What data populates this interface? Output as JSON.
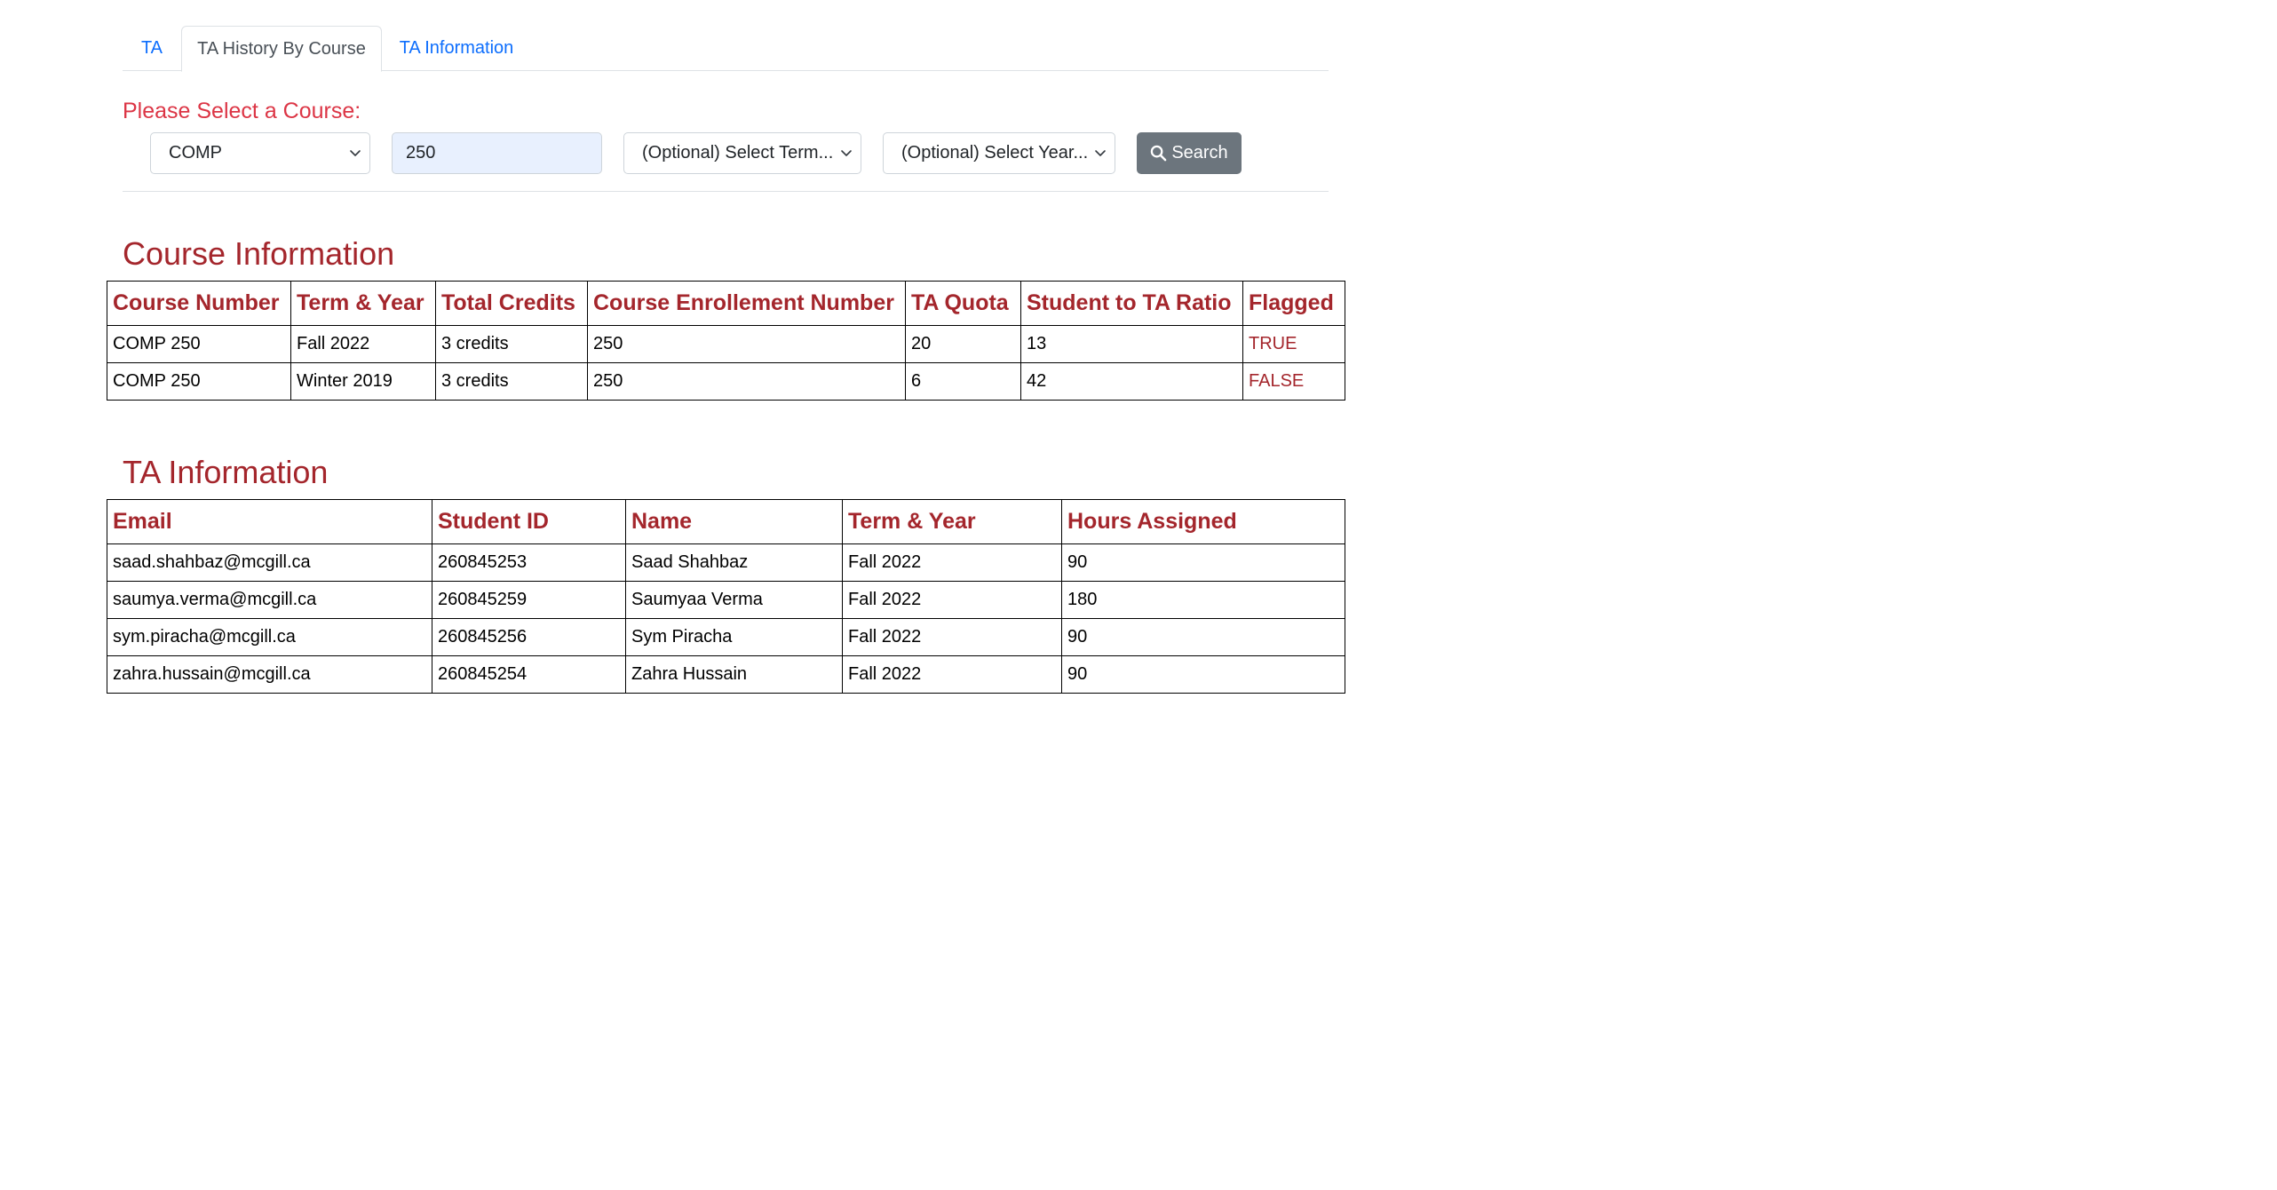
{
  "tabs": [
    {
      "label": "TA",
      "active": false
    },
    {
      "label": "TA History By Course",
      "active": true
    },
    {
      "label": "TA Information",
      "active": false
    }
  ],
  "course_select": {
    "prompt": "Please Select a Course:",
    "department": "COMP",
    "course_number": "250",
    "term_placeholder": "(Optional) Select Term...",
    "year_placeholder": "(Optional) Select Year...",
    "search_label": "Search"
  },
  "course_info": {
    "title": "Course Information",
    "headers": [
      "Course Number",
      "Term & Year",
      "Total Credits",
      "Course Enrollement Number",
      "TA Quota",
      "Student to TA Ratio",
      "Flagged"
    ],
    "rows": [
      [
        "COMP 250",
        "Fall 2022",
        "3 credits",
        "250",
        "20",
        "13",
        "TRUE"
      ],
      [
        "COMP 250",
        "Winter 2019",
        "3 credits",
        "250",
        "6",
        "42",
        "FALSE"
      ]
    ]
  },
  "ta_info": {
    "title": "TA Information",
    "headers": [
      "Email",
      "Student ID",
      "Name",
      "Term & Year",
      "Hours Assigned"
    ],
    "rows": [
      [
        "saad.shahbaz@mcgill.ca",
        "260845253",
        "Saad Shahbaz",
        "Fall 2022",
        "90"
      ],
      [
        "saumya.verma@mcgill.ca",
        "260845259",
        "Saumyaa Verma",
        "Fall 2022",
        "180"
      ],
      [
        "sym.piracha@mcgill.ca",
        "260845256",
        "Sym Piracha",
        "Fall 2022",
        "90"
      ],
      [
        "zahra.hussain@mcgill.ca",
        "260845254",
        "Zahra Hussain",
        "Fall 2022",
        "90"
      ]
    ]
  },
  "colors": {
    "accent_red": "#dc3545",
    "heading_maroon": "#a4262c",
    "link_blue": "#0d6efd",
    "button_gray": "#6c757d"
  }
}
